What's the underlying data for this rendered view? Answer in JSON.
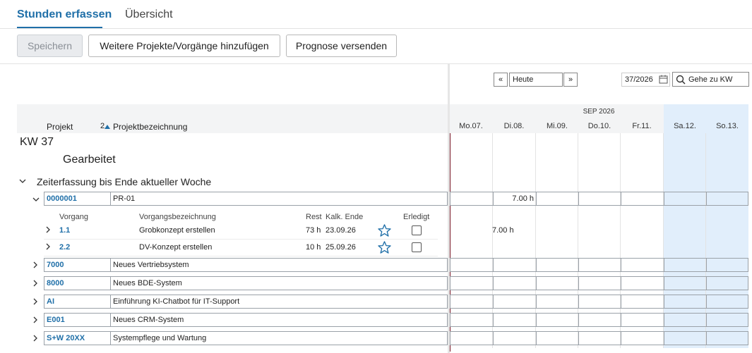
{
  "tabs": [
    {
      "label": "Stunden erfassen",
      "active": true
    },
    {
      "label": "Übersicht",
      "active": false
    }
  ],
  "toolbar": {
    "save_label": "Speichern",
    "add_label": "Weitere Projekte/Vorgänge hinzufügen",
    "forecast_label": "Prognose versenden"
  },
  "nav": {
    "prev": "«",
    "today": "Heute",
    "next": "»",
    "week_value": "37/2026",
    "goto_label": "Gehe zu KW"
  },
  "columns": {
    "projekt": "Projekt",
    "sort_index": "2",
    "bezeichnung": "Projektbezeichnung"
  },
  "month": "SEP 2026",
  "days": [
    "Mo.07.",
    "Di.08.",
    "Mi.09.",
    "Do.10.",
    "Fr.11.",
    "Sa.12.",
    "So.13."
  ],
  "week": {
    "title": "KW 37",
    "subtitle": "Gearbeitet",
    "section": "Zeiterfassung bis Ende aktueller Woche"
  },
  "projects": [
    {
      "code": "0000001",
      "name": "PR-01",
      "expanded": true,
      "hours": [
        "",
        "7.00 h",
        "",
        "",
        "",
        "",
        ""
      ]
    },
    {
      "code": "7000",
      "name": "Neues Vertriebsystem"
    },
    {
      "code": "8000",
      "name": "Neues BDE-System"
    },
    {
      "code": "AI",
      "name": "Einführung KI-Chatbot für IT-Support"
    },
    {
      "code": "E001",
      "name": "Neues CRM-System"
    },
    {
      "code": "S+W 20XX",
      "name": "Systempflege und Wartung"
    }
  ],
  "subheader": {
    "vorgang": "Vorgang",
    "bezeichnung": "Vorgangsbezeichnung",
    "rest": "Rest",
    "kalk_ende": "Kalk. Ende",
    "erledigt": "Erledigt"
  },
  "tasks": [
    {
      "code": "1.1",
      "name": "Grobkonzept erstellen",
      "rest": "73 h",
      "end": "23.09.26",
      "hours_tue": "7.00 h"
    },
    {
      "code": "2.2",
      "name": "DV-Konzept erstellen",
      "rest": "10 h",
      "end": "25.09.26",
      "hours_tue": ""
    }
  ],
  "colors": {
    "accent": "#1f6fa8",
    "weekend": "#e1eefb",
    "today_line": "#7a1a2a"
  }
}
